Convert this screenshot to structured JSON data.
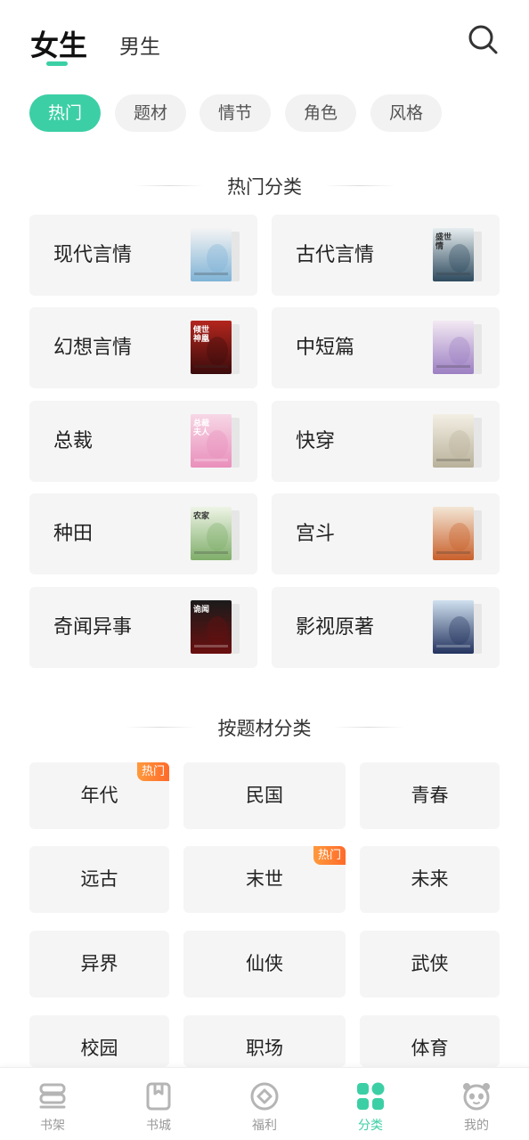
{
  "header": {
    "tabs": [
      {
        "label": "女生",
        "active": true
      },
      {
        "label": "男生",
        "active": false
      }
    ],
    "search_icon": "search-icon"
  },
  "filters": [
    {
      "label": "热门",
      "active": true
    },
    {
      "label": "题材",
      "active": false
    },
    {
      "label": "情节",
      "active": false
    },
    {
      "label": "角色",
      "active": false
    },
    {
      "label": "风格",
      "active": false
    }
  ],
  "hot_section": {
    "title": "热门分类",
    "items": [
      {
        "label": "现代言情",
        "cover_text": "",
        "cover_colors": [
          "#f4f4f4",
          "#7fb3d6"
        ]
      },
      {
        "label": "古代言情",
        "cover_text": "盛世情",
        "cover_colors": [
          "#e7eef0",
          "#2e4a5e"
        ]
      },
      {
        "label": "幻想言情",
        "cover_text": "倾世神凰",
        "cover_colors": [
          "#b3261e",
          "#3a0b0b"
        ]
      },
      {
        "label": "中短篇",
        "cover_text": "",
        "cover_colors": [
          "#f3e9f3",
          "#9c7fc2"
        ]
      },
      {
        "label": "总裁",
        "cover_text": "总裁夫人",
        "cover_colors": [
          "#f7d7e6",
          "#e98fbb"
        ]
      },
      {
        "label": "快穿",
        "cover_text": "",
        "cover_colors": [
          "#f3efe4",
          "#b9b19a"
        ]
      },
      {
        "label": "种田",
        "cover_text": "农家",
        "cover_colors": [
          "#eef4e6",
          "#7fae6a"
        ]
      },
      {
        "label": "宫斗",
        "cover_text": "",
        "cover_colors": [
          "#f3e6d5",
          "#c9602b"
        ]
      },
      {
        "label": "奇闻异事",
        "cover_text": "诡闻",
        "cover_colors": [
          "#1b1b1b",
          "#6b0f0f"
        ]
      },
      {
        "label": "影视原著",
        "cover_text": "",
        "cover_colors": [
          "#cfe0ef",
          "#23335e"
        ]
      }
    ]
  },
  "theme_section": {
    "title": "按题材分类",
    "items": [
      {
        "label": "年代",
        "badge": "热门"
      },
      {
        "label": "民国",
        "badge": ""
      },
      {
        "label": "青春",
        "badge": ""
      },
      {
        "label": "远古",
        "badge": ""
      },
      {
        "label": "末世",
        "badge": "热门"
      },
      {
        "label": "未来",
        "badge": ""
      },
      {
        "label": "异界",
        "badge": ""
      },
      {
        "label": "仙侠",
        "badge": ""
      },
      {
        "label": "武侠",
        "badge": ""
      },
      {
        "label": "校园",
        "badge": ""
      },
      {
        "label": "职场",
        "badge": ""
      },
      {
        "label": "体育",
        "badge": ""
      }
    ]
  },
  "bottom_nav": [
    {
      "label": "书架",
      "icon": "bookshelf-icon",
      "active": false
    },
    {
      "label": "书城",
      "icon": "bookstore-icon",
      "active": false
    },
    {
      "label": "福利",
      "icon": "rewards-icon",
      "active": false
    },
    {
      "label": "分类",
      "icon": "category-icon",
      "active": true
    },
    {
      "label": "我的",
      "icon": "profile-icon",
      "active": false
    }
  ],
  "colors": {
    "accent": "#3ccfa5",
    "badge": "#ff7a2e",
    "card_bg": "#f5f5f5",
    "chip_bg": "#f2f2f2"
  }
}
